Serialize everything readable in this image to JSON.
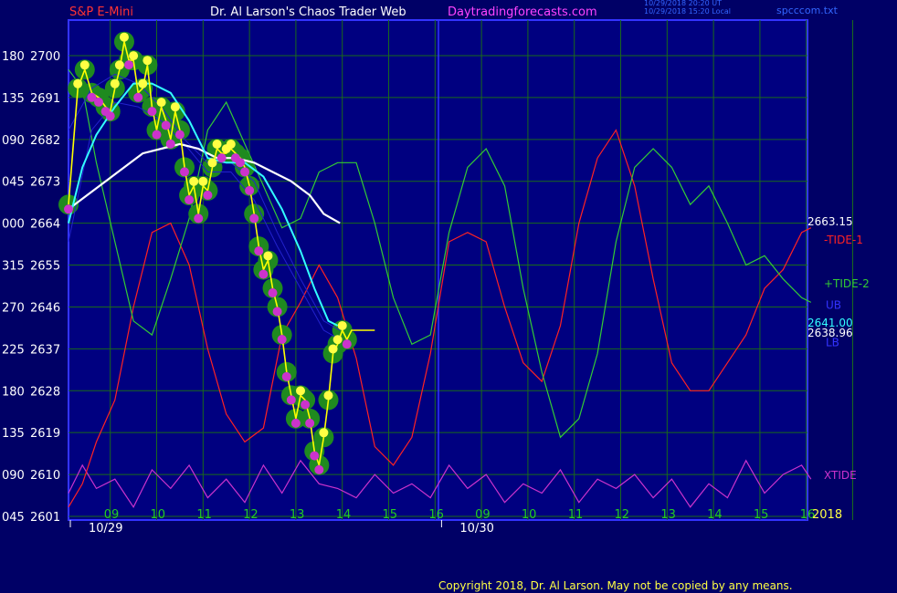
{
  "header": {
    "instrument": "S&P E-Mini",
    "title": "Dr. Al Larson's Chaos Trader Web",
    "site": "Daytradingforecasts.com",
    "timestamp_ut": "10/29/2018 20:20 UT",
    "timestamp_local": "10/29/2018 15:20 Local",
    "file": "spcccom.txt"
  },
  "colors": {
    "background": "#000066",
    "plot_background": "#000080",
    "frame": "#3333ff",
    "grid": "#1a6a1a",
    "price": "#ffff00",
    "ma_cyan": "#33ffff",
    "ma_white": "#ffffff",
    "tide1": "#ff2222",
    "tide2": "#33cc33",
    "xtide": "#cc33cc",
    "bands": "#2222cc",
    "halo": "#1f8a1f",
    "dot_high": "#ffff44",
    "dot_low": "#cc33cc"
  },
  "chart_data": {
    "type": "line",
    "title": "S&P E-Mini",
    "y_axis": {
      "price_ticks": [
        2700,
        2691,
        2682,
        2673,
        2664,
        2655,
        2646,
        2637,
        2628,
        2619,
        2610,
        2601
      ],
      "angle_ticks": [
        "180",
        "135",
        "090",
        "045",
        "000",
        "315",
        "270",
        "225",
        "180",
        "135",
        "090",
        "045"
      ],
      "ylim": [
        2601,
        2700
      ]
    },
    "x_axis": {
      "hour_ticks": [
        "09",
        "10",
        "11",
        "12",
        "13",
        "14",
        "15",
        "16",
        "09",
        "10",
        "11",
        "12",
        "13",
        "14",
        "15",
        "16"
      ],
      "date_labels": [
        "10/29",
        "10/30"
      ],
      "year": "2018"
    },
    "right_labels": {
      "last_price": "2663.15",
      "tide1": "-TIDE-1",
      "tide2": "+TIDE-2",
      "ub_value": "2641.00",
      "ub": "UB",
      "lb_value": "2638.96",
      "lb": "LB",
      "xtide": "XTIDE"
    },
    "series": [
      {
        "name": "S&P E-Mini",
        "key": "price",
        "x": [
          0,
          0.2,
          0.35,
          0.5,
          0.65,
          0.8,
          0.9,
          1.0,
          1.1,
          1.2,
          1.3,
          1.4,
          1.5,
          1.6,
          1.7,
          1.8,
          1.9,
          2.0,
          2.1,
          2.2,
          2.3,
          2.4,
          2.5,
          2.6,
          2.7,
          2.8,
          2.9,
          3.0,
          3.1,
          3.2,
          3.3,
          3.4,
          3.5,
          3.6,
          3.7,
          3.8,
          3.9,
          4.0,
          4.1,
          4.2,
          4.3,
          4.4,
          4.5,
          4.6,
          4.7,
          4.8,
          4.9,
          5.0,
          5.1,
          5.2,
          5.3,
          5.4,
          5.5,
          5.6,
          5.7,
          5.8,
          5.9,
          6.0,
          6.1,
          6.2,
          6.3,
          6.4,
          6.6
        ],
        "y": [
          2668,
          2693,
          2697,
          2692,
          2691,
          2689,
          2688,
          2693,
          2697,
          2703,
          2699,
          2699,
          2692,
          2693,
          2698,
          2689,
          2684,
          2689,
          2686,
          2682,
          2688,
          2684,
          2676,
          2670,
          2672,
          2666,
          2672,
          2671,
          2676,
          2680,
          2679,
          2679,
          2680,
          2679,
          2678,
          2676,
          2672,
          2666,
          2659,
          2654,
          2656,
          2650,
          2646,
          2640,
          2632,
          2627,
          2622,
          2627,
          2626,
          2622,
          2615,
          2612,
          2618,
          2626,
          2636,
          2638,
          2641,
          2639,
          2641,
          2641,
          2641,
          2641,
          2641
        ]
      },
      {
        "name": "UB",
        "key": "ub",
        "x": [
          0,
          0.5,
          1.0,
          1.5,
          2.0,
          2.5,
          3.0,
          3.5,
          4.0,
          4.5,
          5.0,
          5.5,
          5.85
        ],
        "y": [
          2684,
          2693,
          2696,
          2694,
          2689,
          2682,
          2677,
          2677,
          2673,
          2662,
          2652,
          2643,
          2641
        ]
      },
      {
        "name": "LB",
        "key": "lb",
        "x": [
          0,
          0.5,
          1.0,
          1.5,
          2.0,
          2.5,
          3.0,
          3.5,
          4.0,
          4.5,
          5.0,
          5.5,
          5.85
        ],
        "y": [
          2660,
          2684,
          2690,
          2689,
          2686,
          2681,
          2675,
          2675,
          2669,
          2659,
          2650,
          2641,
          2639
        ]
      },
      {
        "name": "MA",
        "key": "ma_cyan",
        "x": [
          0,
          0.3,
          0.6,
          1.0,
          1.4,
          1.8,
          2.2,
          2.6,
          3.0,
          3.4,
          3.8,
          4.2,
          4.6,
          5.0,
          5.3,
          5.6,
          5.8
        ],
        "y": [
          2664,
          2676,
          2683,
          2689,
          2694,
          2694,
          2692,
          2686,
          2678,
          2677,
          2677,
          2674,
          2667,
          2658,
          2650,
          2643,
          2642
        ]
      },
      {
        "name": "MA2",
        "key": "ma_white",
        "x": [
          0,
          0.4,
          0.8,
          1.2,
          1.6,
          2.0,
          2.4,
          2.8,
          3.2,
          3.6,
          4.0,
          4.4,
          4.8,
          5.2,
          5.5,
          5.85
        ],
        "y": [
          2667,
          2670,
          2673,
          2676,
          2679,
          2680,
          2681,
          2680,
          2678,
          2678,
          2677,
          2675,
          2673,
          2670,
          2666,
          2664
        ]
      },
      {
        "name": "-TIDE-1",
        "key": "tide1",
        "x": [
          0,
          0.3,
          0.6,
          1.0,
          1.4,
          1.8,
          2.2,
          2.6,
          3.0,
          3.4,
          3.8,
          4.2,
          4.6,
          5.0,
          5.4,
          5.8,
          6.2,
          6.6,
          7.0,
          7.4,
          7.8,
          8.2,
          8.6,
          9.0,
          9.4,
          9.8,
          10.2,
          10.6,
          11.0,
          11.4,
          11.8,
          12.2,
          12.6,
          13.0,
          13.4,
          13.8,
          14.2,
          14.6,
          15.0,
          15.4,
          15.8,
          16.0
        ],
        "y": [
          2603,
          2608,
          2617,
          2626,
          2646,
          2662,
          2664,
          2655,
          2637,
          2623,
          2617,
          2620,
          2640,
          2647,
          2655,
          2648,
          2635,
          2616,
          2612,
          2618,
          2636,
          2660,
          2662,
          2660,
          2646,
          2634,
          2630,
          2642,
          2664,
          2678,
          2684,
          2672,
          2652,
          2634,
          2628,
          2628,
          2634,
          2640,
          2650,
          2654,
          2662,
          2663
        ]
      },
      {
        "name": "+TIDE-2",
        "key": "tide2",
        "x": [
          0,
          0.3,
          0.6,
          1.0,
          1.4,
          1.8,
          2.2,
          2.6,
          3.0,
          3.4,
          3.8,
          4.2,
          4.6,
          5.0,
          5.4,
          5.8,
          6.2,
          6.6,
          7.0,
          7.4,
          7.8,
          8.2,
          8.6,
          9.0,
          9.4,
          9.8,
          10.2,
          10.6,
          11.0,
          11.4,
          11.8,
          12.2,
          12.6,
          13.0,
          13.4,
          13.8,
          14.2,
          14.6,
          15.0,
          15.4,
          15.8,
          16.0
        ],
        "y": [
          2697,
          2693,
          2677,
          2660,
          2643,
          2640,
          2652,
          2665,
          2684,
          2690,
          2681,
          2672,
          2663,
          2665,
          2675,
          2677,
          2677,
          2664,
          2648,
          2638,
          2640,
          2662,
          2676,
          2680,
          2672,
          2650,
          2632,
          2618,
          2622,
          2636,
          2660,
          2676,
          2680,
          2676,
          2668,
          2672,
          2664,
          2655,
          2657,
          2652,
          2648,
          2647
        ]
      },
      {
        "name": "XTIDE",
        "key": "xtide",
        "x": [
          0,
          0.3,
          0.6,
          1.0,
          1.4,
          1.8,
          2.2,
          2.6,
          3.0,
          3.4,
          3.8,
          4.2,
          4.6,
          5.0,
          5.4,
          5.8,
          6.2,
          6.6,
          7.0,
          7.4,
          7.8,
          8.2,
          8.6,
          9.0,
          9.4,
          9.8,
          10.2,
          10.6,
          11.0,
          11.4,
          11.8,
          12.2,
          12.6,
          13.0,
          13.4,
          13.8,
          14.2,
          14.6,
          15.0,
          15.4,
          15.8,
          16.0
        ],
        "y": [
          2606,
          2612,
          2607,
          2609,
          2603,
          2611,
          2607,
          2612,
          2605,
          2609,
          2604,
          2612,
          2606,
          2613,
          2608,
          2607,
          2605,
          2610,
          2606,
          2608,
          2605,
          2612,
          2607,
          2610,
          2604,
          2608,
          2606,
          2611,
          2604,
          2609,
          2607,
          2610,
          2605,
          2609,
          2603,
          2608,
          2605,
          2613,
          2606,
          2610,
          2612,
          2609
        ]
      }
    ]
  },
  "copyright": "Copyright 2018, Dr. Al Larson. May not be copied by any means."
}
